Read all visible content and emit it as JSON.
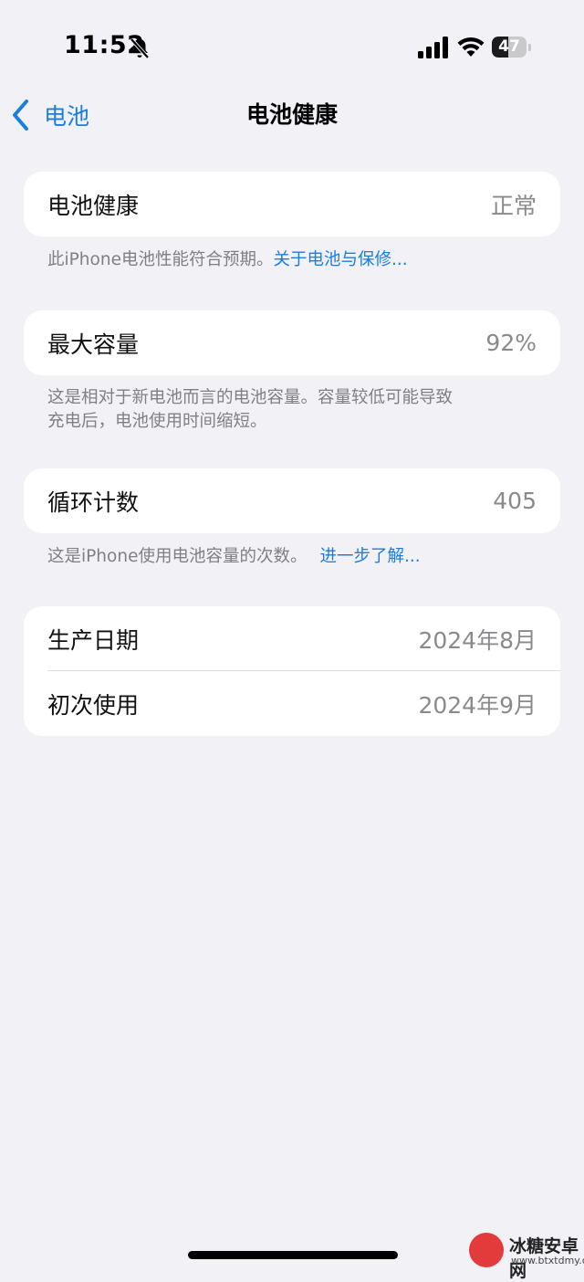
{
  "status": {
    "time": "11:52",
    "battery_level": "47",
    "battery_fraction": 0.47
  },
  "nav": {
    "back_label": "电池",
    "title": "电池健康"
  },
  "health": {
    "label": "电池健康",
    "value": "正常",
    "footer": "此iPhone电池性能符合预期。",
    "footer_link": "关于电池与保修..."
  },
  "capacity": {
    "label": "最大容量",
    "value": "92%",
    "footer_line1": "这是相对于新电池而言的电池容量。容量较低可能导致",
    "footer_line2": "充电后，电池使用时间缩短。"
  },
  "cycles": {
    "label": "循环计数",
    "value": "405",
    "footer": "这是iPhone使用电池容量的次数。",
    "footer_link": "进一步了解..."
  },
  "dates": {
    "manufacture_label": "生产日期",
    "manufacture_value": "2024年8月",
    "first_use_label": "初次使用",
    "first_use_value": "2024年9月"
  },
  "watermark": {
    "title": "冰糖安卓网",
    "url": "www.btxtdmy.com"
  },
  "colors": {
    "accent": "#1a7ee0",
    "background": "#f2f1f6",
    "card": "#ffffff",
    "secondary_text": "#8a8a8e"
  }
}
